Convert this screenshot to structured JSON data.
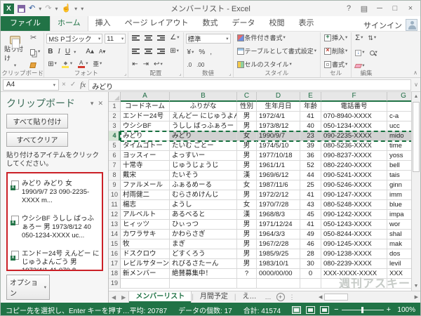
{
  "window": {
    "title": "メンバーリスト - Excel",
    "signin": "サインイン"
  },
  "ribbon": {
    "tabs": [
      "ファイル",
      "ホーム",
      "挿入",
      "ページ レイアウト",
      "数式",
      "データ",
      "校閲",
      "表示"
    ],
    "active_tab": "ホーム",
    "groups": {
      "clipboard": {
        "label": "クリップボード",
        "paste": "貼り付け"
      },
      "font": {
        "label": "フォント",
        "name": "MS Pゴシック",
        "size": "11"
      },
      "alignment": {
        "label": "配置"
      },
      "number": {
        "label": "数値",
        "format": "標準"
      },
      "styles": {
        "label": "スタイル",
        "conditional": "条件付き書式",
        "table": "テーブルとして書式設定",
        "cell": "セルのスタイル"
      },
      "cells": {
        "label": "セル",
        "insert": "挿入",
        "del": "削除",
        "format": "書式"
      },
      "editing": {
        "label": "編集"
      }
    }
  },
  "formula_bar": {
    "name_box": "A4",
    "value": "みどり"
  },
  "clipboard_pane": {
    "title": "クリップボード",
    "paste_all": "すべて貼り付け",
    "clear_all": "すべてクリア",
    "instruction": "貼り付けるアイテムをクリックしてください。",
    "items": [
      "みどり みどり 女 1990/9/7 23 090-2235-XXXX m...",
      "ウシシBF うしし ばっふぁろー 男 1973/8/12 40 050-1234-XXXX uc...",
      "エンドー24号 えんどー にじゅうよんごう 男 1972/4/1 41 070-8..."
    ],
    "options": "オプション"
  },
  "grid": {
    "columns": [
      "A",
      "B",
      "C",
      "D",
      "E",
      "F",
      "G"
    ],
    "header_row": [
      "コードネーム",
      "ふりがな",
      "性別",
      "生年月日",
      "年齢",
      "電話番号",
      ""
    ],
    "rows": [
      [
        "エンドー24号",
        "えんどー にじゅうよんごう",
        "男",
        "1972/4/1",
        "41",
        "070-8940-XXXX",
        "c-a"
      ],
      [
        "ウシシBF",
        "うしし ばっふぁろー",
        "男",
        "1973/8/12",
        "40",
        "050-1234-XXXX",
        "ucc"
      ],
      [
        "みどり",
        "みどり",
        "女",
        "1990/9/7",
        "23",
        "090-2235-XXXX",
        "mido"
      ],
      [
        "タイムゴトー",
        "たいむ ごとー",
        "男",
        "1974/5/10",
        "39",
        "080-5236-XXXX",
        "time"
      ],
      [
        "ヨッスィー",
        "よっすいー",
        "男",
        "1977/10/18",
        "36",
        "090-8237-XXXX",
        "yoss"
      ],
      [
        "十常寺",
        "じゅうじょうじ",
        "男",
        "1961/1/1",
        "52",
        "080-2240-XXXX",
        "bell"
      ],
      [
        "戴宋",
        "たいそう",
        "漢",
        "1969/6/12",
        "44",
        "090-5241-XXXX",
        "tais"
      ],
      [
        "ファルメール",
        "ふぁるめーる",
        "女",
        "1987/11/6",
        "25",
        "090-5246-XXXX",
        "ginn"
      ],
      [
        "村雨健二",
        "むらさめけんじ",
        "男",
        "1972/2/12",
        "41",
        "090-1247-XXXX",
        "imm"
      ],
      [
        "楊志",
        "ようし",
        "女",
        "1970/7/28",
        "43",
        "080-5248-XXXX",
        "blue"
      ],
      [
        "アルベルト",
        "あるべると",
        "漢",
        "1968/8/3",
        "45",
        "090-1242-XXXX",
        "impa"
      ],
      [
        "ヒィッツ",
        "ひぃっつ",
        "男",
        "1971/12/24",
        "41",
        "050-1243-XXXX",
        "wor"
      ],
      [
        "カワラサキ",
        "かわらさぎ",
        "男",
        "1964/3/3",
        "49",
        "050-8244-XXXX",
        "shal"
      ],
      [
        "牧",
        "まぎ",
        "男",
        "1967/2/28",
        "46",
        "090-1245-XXXX",
        "mak"
      ],
      [
        "ドスクロウ",
        "どすくろう",
        "男",
        "1985/9/25",
        "28",
        "090-1238-XXXX",
        "dos"
      ],
      [
        "レビルサターン",
        "れびるさたーん",
        "男",
        "1983/10/1",
        "30",
        "080-2239-XXXX",
        "levil"
      ],
      [
        "新メンバー",
        "絶賛募集中！",
        "?",
        "0000/00/00",
        "0",
        "XXX-XXXX-XXXX",
        "XXX"
      ]
    ],
    "selected_row": 4,
    "active_cell": "A4",
    "visible_rows": 19
  },
  "sheet_tabs": {
    "tabs": [
      "メンバーリスト",
      "月間予定",
      "え…"
    ],
    "active": "メンバーリスト"
  },
  "status_bar": {
    "message": "コピー先を選択し、Enter キーを押す…",
    "average": "平均: 20787",
    "count": "データの個数: 17",
    "sum": "合計: 41574",
    "zoom": "100%"
  },
  "watermark": "週刊アスキー"
}
